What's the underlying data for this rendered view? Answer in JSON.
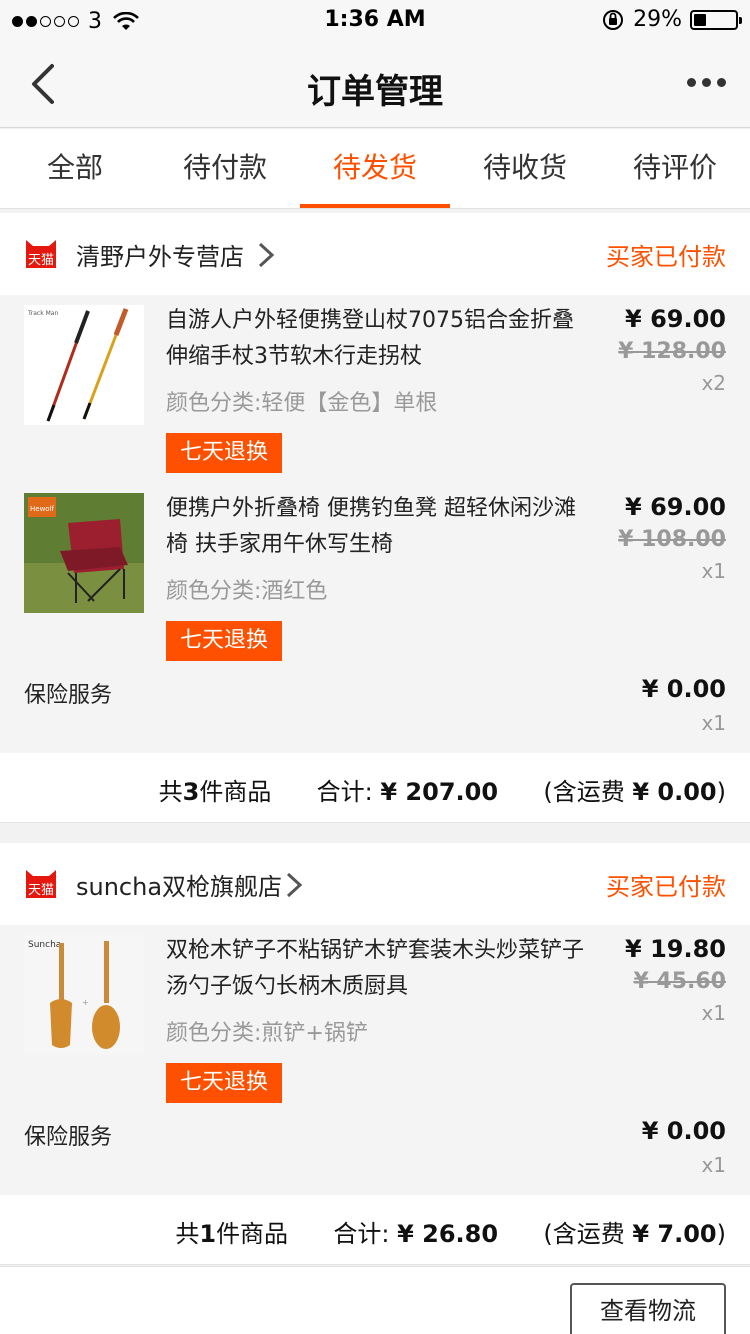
{
  "status_bar": {
    "carrier": "3",
    "time": "1:36 AM",
    "battery": "29%",
    "battery_level": 0.29
  },
  "nav": {
    "title": "订单管理"
  },
  "tabs": [
    {
      "label": "全部"
    },
    {
      "label": "待付款"
    },
    {
      "label": "待发货",
      "active": true
    },
    {
      "label": "待收货"
    },
    {
      "label": "待评价"
    }
  ],
  "badge_text": "天猫",
  "orders": [
    {
      "shop": "清野户外专营店",
      "status": "买家已付款",
      "items": [
        {
          "name": "自游人户外轻便携登山杖7075铝合金折叠伸缩手杖3节软木行走拐杖",
          "sku": "颜色分类:轻便【金色】单根",
          "tag": "七天退换",
          "price": "¥ 69.00",
          "orig": "¥ 128.00",
          "qty": "x2",
          "thumb_brand": "Track Man"
        },
        {
          "name": "便携户外折叠椅 便携钓鱼凳 超轻休闲沙滩椅 扶手家用午休写生椅",
          "sku": "颜色分类:酒红色",
          "tag": "七天退换",
          "price": "¥ 69.00",
          "orig": "¥ 108.00",
          "qty": "x1",
          "thumb_brand": "Hewolf"
        }
      ],
      "insurance": {
        "label": "保险服务",
        "price": "¥ 0.00",
        "qty": "x1"
      },
      "summary": {
        "count_pre": "共",
        "count": "3",
        "count_post": "件商品",
        "total_label": "合计:",
        "total": "¥ 207.00",
        "ship_pre": "(含运费",
        "ship": "¥ 0.00",
        "ship_post": ")"
      }
    },
    {
      "shop": "suncha双枪旗舰店",
      "status": "买家已付款",
      "items": [
        {
          "name": "双枪木铲子不粘锅铲木铲套装木头炒菜铲子汤勺子饭勺长柄木质厨具",
          "sku": "颜色分类:煎铲+锅铲",
          "tag": "七天退换",
          "price": "¥ 19.80",
          "orig": "¥ 45.60",
          "qty": "x1",
          "thumb_brand": "Suncha"
        }
      ],
      "insurance": {
        "label": "保险服务",
        "price": "¥ 0.00",
        "qty": "x1"
      },
      "summary": {
        "count_pre": "共",
        "count": "1",
        "count_post": "件商品",
        "total_label": "合计:",
        "total": "¥ 26.80",
        "ship_pre": "(含运费",
        "ship": "¥ 7.00",
        "ship_post": ")"
      }
    }
  ],
  "footer": {
    "logistics_button": "查看物流"
  },
  "colors": {
    "accent": "#ff5000",
    "muted": "#999999",
    "card_bg": "#f4f4f4"
  }
}
